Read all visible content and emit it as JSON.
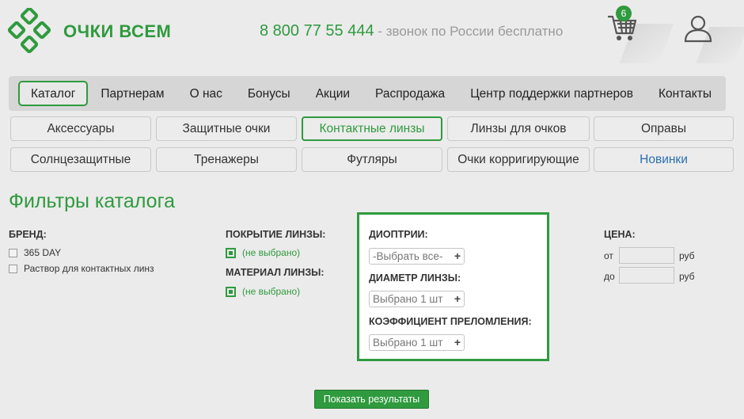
{
  "header": {
    "logo_text": "ОЧКИ ВСЕМ",
    "phone": "8 800 77 55 444",
    "phone_note": " - звонок по России бесплатно",
    "cart_count": "6",
    "cart_icon": "cart-icon",
    "user_icon": "user-icon",
    "brand_color": "#2f9a3e"
  },
  "main_nav": [
    {
      "label": "Каталог",
      "active": true
    },
    {
      "label": "Партнерам"
    },
    {
      "label": "О нас"
    },
    {
      "label": "Бонусы"
    },
    {
      "label": "Акции"
    },
    {
      "label": "Распродажа"
    },
    {
      "label": "Центр поддержки партнеров"
    },
    {
      "label": "Контакты"
    }
  ],
  "categories": [
    {
      "label": "Аксессуары"
    },
    {
      "label": "Защитные очки"
    },
    {
      "label": "Контактные линзы",
      "active": true
    },
    {
      "label": "Линзы для очков"
    },
    {
      "label": "Оправы"
    },
    {
      "label": "Солнцезащитные"
    },
    {
      "label": "Тренажеры"
    },
    {
      "label": "Футляры"
    },
    {
      "label": "Очки корригирующие"
    },
    {
      "label": "Новинки",
      "link": true
    }
  ],
  "filters": {
    "title": "Фильтры каталога",
    "brand": {
      "label": "БРЕНД:",
      "options": [
        "365 DAY",
        "Раствор для контактных линз"
      ]
    },
    "coating": {
      "label": "ПОКРЫТИЕ ЛИНЗЫ:",
      "value": "(не выбрано)"
    },
    "material": {
      "label": "МАТЕРИАЛ ЛИНЗЫ:",
      "value": "(не выбрано)"
    },
    "diopters": {
      "label": "ДИОПТРИИ:",
      "value": "-Выбрать все-"
    },
    "diameter": {
      "label": "ДИАМЕТР ЛИНЗЫ:",
      "value": "Выбрано 1 шт"
    },
    "refraction": {
      "label": "КОЭФФИЦИЕНТ ПРЕЛОМЛЕНИЯ:",
      "value": "Выбрано 1 шт"
    },
    "price": {
      "label": "ЦЕНА:",
      "from_label": "от",
      "to_label": "до",
      "currency": "руб"
    },
    "show_button": "Показать результаты"
  }
}
